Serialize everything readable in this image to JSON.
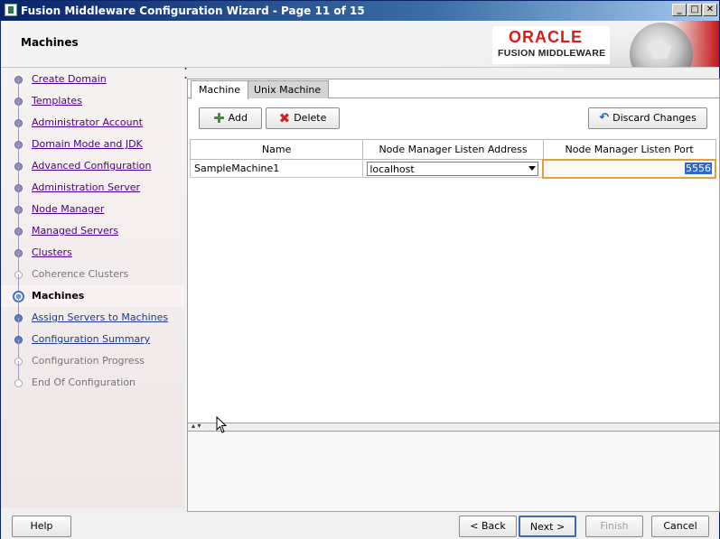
{
  "window": {
    "title": "Fusion Middleware Configuration Wizard - Page 11 of 15",
    "minimize": "_",
    "maximize": "□",
    "close": "✕"
  },
  "header": {
    "page_title": "Machines",
    "brand": "ORACLE",
    "brand_sub": "FUSION MIDDLEWARE"
  },
  "nav": {
    "items": [
      {
        "label": "Create Domain",
        "state": "done"
      },
      {
        "label": "Templates",
        "state": "done"
      },
      {
        "label": "Administrator Account",
        "state": "done"
      },
      {
        "label": "Domain Mode and JDK",
        "state": "done"
      },
      {
        "label": "Advanced Configuration",
        "state": "done"
      },
      {
        "label": "Administration Server",
        "state": "done"
      },
      {
        "label": "Node Manager",
        "state": "done"
      },
      {
        "label": "Managed Servers",
        "state": "done"
      },
      {
        "label": "Clusters",
        "state": "done"
      },
      {
        "label": "Coherence Clusters",
        "state": "disabled"
      },
      {
        "label": "Machines",
        "state": "current"
      },
      {
        "label": "Assign Servers to Machines",
        "state": "future"
      },
      {
        "label": "Configuration Summary",
        "state": "future"
      },
      {
        "label": "Configuration Progress",
        "state": "disabled"
      },
      {
        "label": "End Of Configuration",
        "state": "disabled"
      }
    ]
  },
  "tabs": {
    "machine": "Machine",
    "unix_machine": "Unix Machine"
  },
  "toolbar": {
    "add": "Add",
    "delete": "Delete",
    "discard": "Discard Changes"
  },
  "table": {
    "columns": [
      "Name",
      "Node Manager Listen Address",
      "Node Manager Listen Port"
    ],
    "rows": [
      {
        "name": "SampleMachine1",
        "address": "localhost",
        "port": "5556"
      }
    ]
  },
  "footer": {
    "help": "Help",
    "back": "< Back",
    "next": "Next >",
    "finish": "Finish",
    "cancel": "Cancel"
  }
}
